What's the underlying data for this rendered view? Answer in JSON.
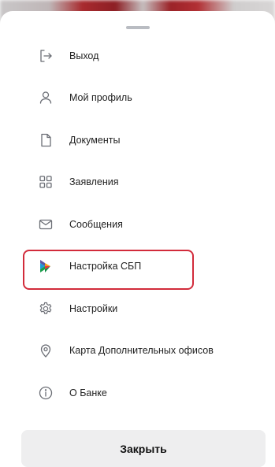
{
  "menu": {
    "items": [
      {
        "label": "Выход",
        "icon": "logout-icon"
      },
      {
        "label": "Мой профиль",
        "icon": "user-icon"
      },
      {
        "label": "Документы",
        "icon": "document-icon"
      },
      {
        "label": "Заявления",
        "icon": "grid-icon"
      },
      {
        "label": "Сообщения",
        "icon": "envelope-icon"
      },
      {
        "label": "Настройка СБП",
        "icon": "sbp-logo-icon",
        "highlighted": true
      },
      {
        "label": "Настройки",
        "icon": "gear-icon"
      },
      {
        "label": "Карта Дополнительных офисов",
        "icon": "map-pin-icon"
      },
      {
        "label": "О Банке",
        "icon": "info-icon"
      }
    ]
  },
  "close_label": "Закрыть",
  "colors": {
    "highlight_border": "#d22b3b",
    "icon_stroke": "#6b6e75",
    "close_bg": "#eeeeef"
  }
}
